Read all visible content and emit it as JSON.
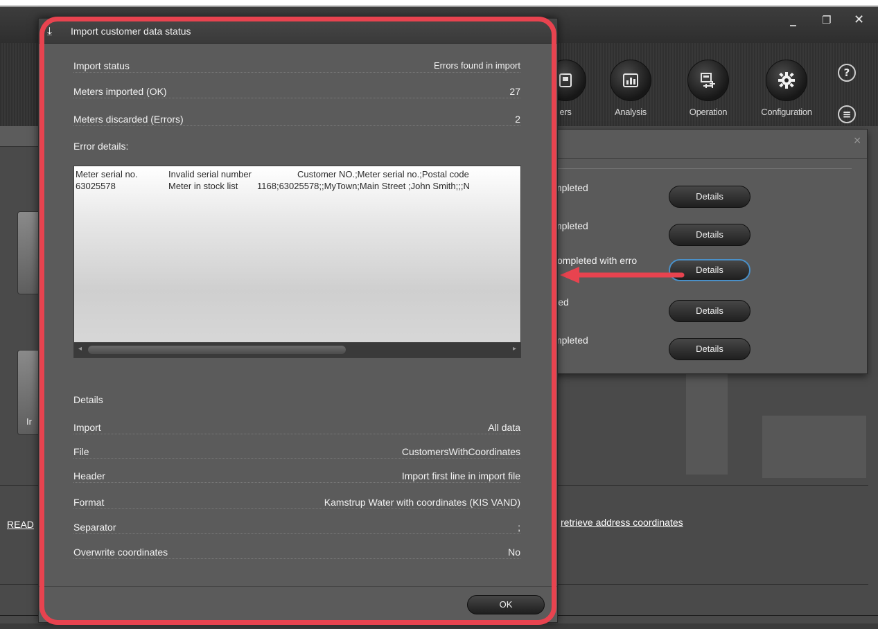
{
  "window": {
    "minimize": "_",
    "restore": "❐",
    "close": "✕"
  },
  "ribbon": {
    "items": [
      {
        "label": "ers",
        "icon": "meters-icon"
      },
      {
        "label": "Analysis",
        "icon": "analysis-chart-icon"
      },
      {
        "label": "Operation",
        "icon": "operation-icon"
      },
      {
        "label": "Configuration",
        "icon": "gear-icon"
      }
    ],
    "help": "?",
    "list_icon": "≡"
  },
  "background": {
    "left_text_1": "Ir",
    "left_link": "READ",
    "link_right": "retrieve address coordinates"
  },
  "status_panel": {
    "rows": [
      {
        "label": "mpleted",
        "button": "Details"
      },
      {
        "label": "mpleted",
        "button": "Details"
      },
      {
        "label": "completed with erro",
        "button": "Details"
      },
      {
        "label": "iled",
        "button": "Details"
      },
      {
        "label": "mpleted",
        "button": "Details"
      }
    ],
    "close": "×"
  },
  "dialog": {
    "title": "Import customer data status",
    "title_icon": "import-arrow-icon",
    "import_status_label": "Import status",
    "import_status_value": "Errors found in import",
    "meters_ok_label": "Meters imported (OK)",
    "meters_ok_value": "27",
    "meters_err_label": "Meters discarded (Errors)",
    "meters_err_value": "2",
    "error_details_label": "Error details:",
    "error_rows": [
      {
        "serial": "Meter serial no.",
        "reason": "Invalid serial number",
        "data": "Customer NO.;Meter serial no.;Postal code"
      },
      {
        "serial": "63025578",
        "reason": "Meter in stock list",
        "data": "1168;63025578;;MyTown;Main Street ;John Smith;;;N"
      }
    ],
    "details_label": "Details",
    "details": [
      {
        "label": "Import",
        "value": "All data"
      },
      {
        "label": "File",
        "value": "CustomersWithCoordinates"
      },
      {
        "label": "Header",
        "value": "Import first line in import file"
      },
      {
        "label": "Format",
        "value": "Kamstrup Water with coordinates (KIS VAND)"
      },
      {
        "label": "Separator",
        "value": ";"
      },
      {
        "label": "Overwrite coordinates",
        "value": "No"
      }
    ],
    "ok_button": "OK"
  },
  "colors": {
    "highlight": "#e8434f",
    "focus": "#4a90c8"
  }
}
